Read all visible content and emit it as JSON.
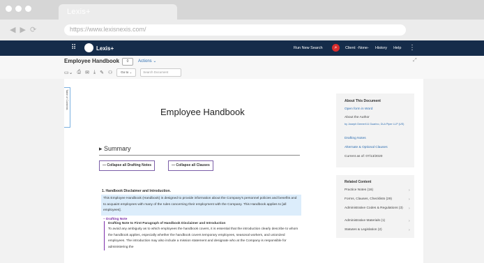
{
  "browser": {
    "tab_title": "Lexis+",
    "url": "https://www.lexisnexis.com/",
    "back_icon": "back-arrow",
    "forward_icon": "forward-arrow",
    "reload_icon": "reload"
  },
  "app": {
    "brand": "Lexis+",
    "run_new_search": "Run New Search",
    "client": "Client: -None-",
    "history": "History",
    "help": "Help"
  },
  "document": {
    "title": "Employee Handbook",
    "badge": "0",
    "actions": "Actions ⌄",
    "goto": "Go to ⌄",
    "search_placeholder": "Search Document",
    "toc_label": "Table of Contents",
    "heading": "Employee Handbook",
    "summary": "Summary",
    "collapse_notes": "— Collapse all Drafting Notes",
    "collapse_clauses": "— Collapse all Clauses",
    "section_heading": "1. Handbook Disclaimer and Introduction.",
    "section_text": "This Employee Handbook (Handbook) is designed to provide information about the Company's personnel policies and benefits and to acquaint employees with many of the rules concerning their employment with the Company. This Handbook applies to [all employees].",
    "drafting_note_toggle": "– Drafting Note",
    "drafting_note_title": "Drafting Note to First Paragraph of Handbook Disclaimer and Introduction",
    "drafting_note_text": "To avoid any ambiguity as to which employees the handbook covers, it is essential that the introduction clearly describe to whom the handbook applies, especially whether the handbook covers temporary employees, seasonal workers, and unionized employees. The introduction may also include a mission statement and designate who at the Company is responsible for administering the"
  },
  "sidebar": {
    "about_heading": "About This Document",
    "open_word": "Open form in Word",
    "about_author": "About the Author",
    "author": "by Joseph Demeril & Guarino, DLA Piper LLP (US)",
    "drafting_notes": "Drafting Notes",
    "alt_clauses": "Alternate & Optional Clauses",
    "current": "Current as of: 07/13/2020",
    "related_heading": "Related Content",
    "related": [
      {
        "label": "Practice Notes (16)"
      },
      {
        "label": "Forms, Clauses, Checklists (29)"
      },
      {
        "label": "Administrative Codes & Regulations (3)"
      },
      {
        "label": "Administrative Materials (1)"
      },
      {
        "label": "Statutes & Legislation (2)"
      }
    ]
  },
  "colors": {
    "navbar": "#152c4a",
    "accent": "#2b6cb0",
    "highlight": "#dcedfb",
    "note": "#7b2ca8"
  }
}
